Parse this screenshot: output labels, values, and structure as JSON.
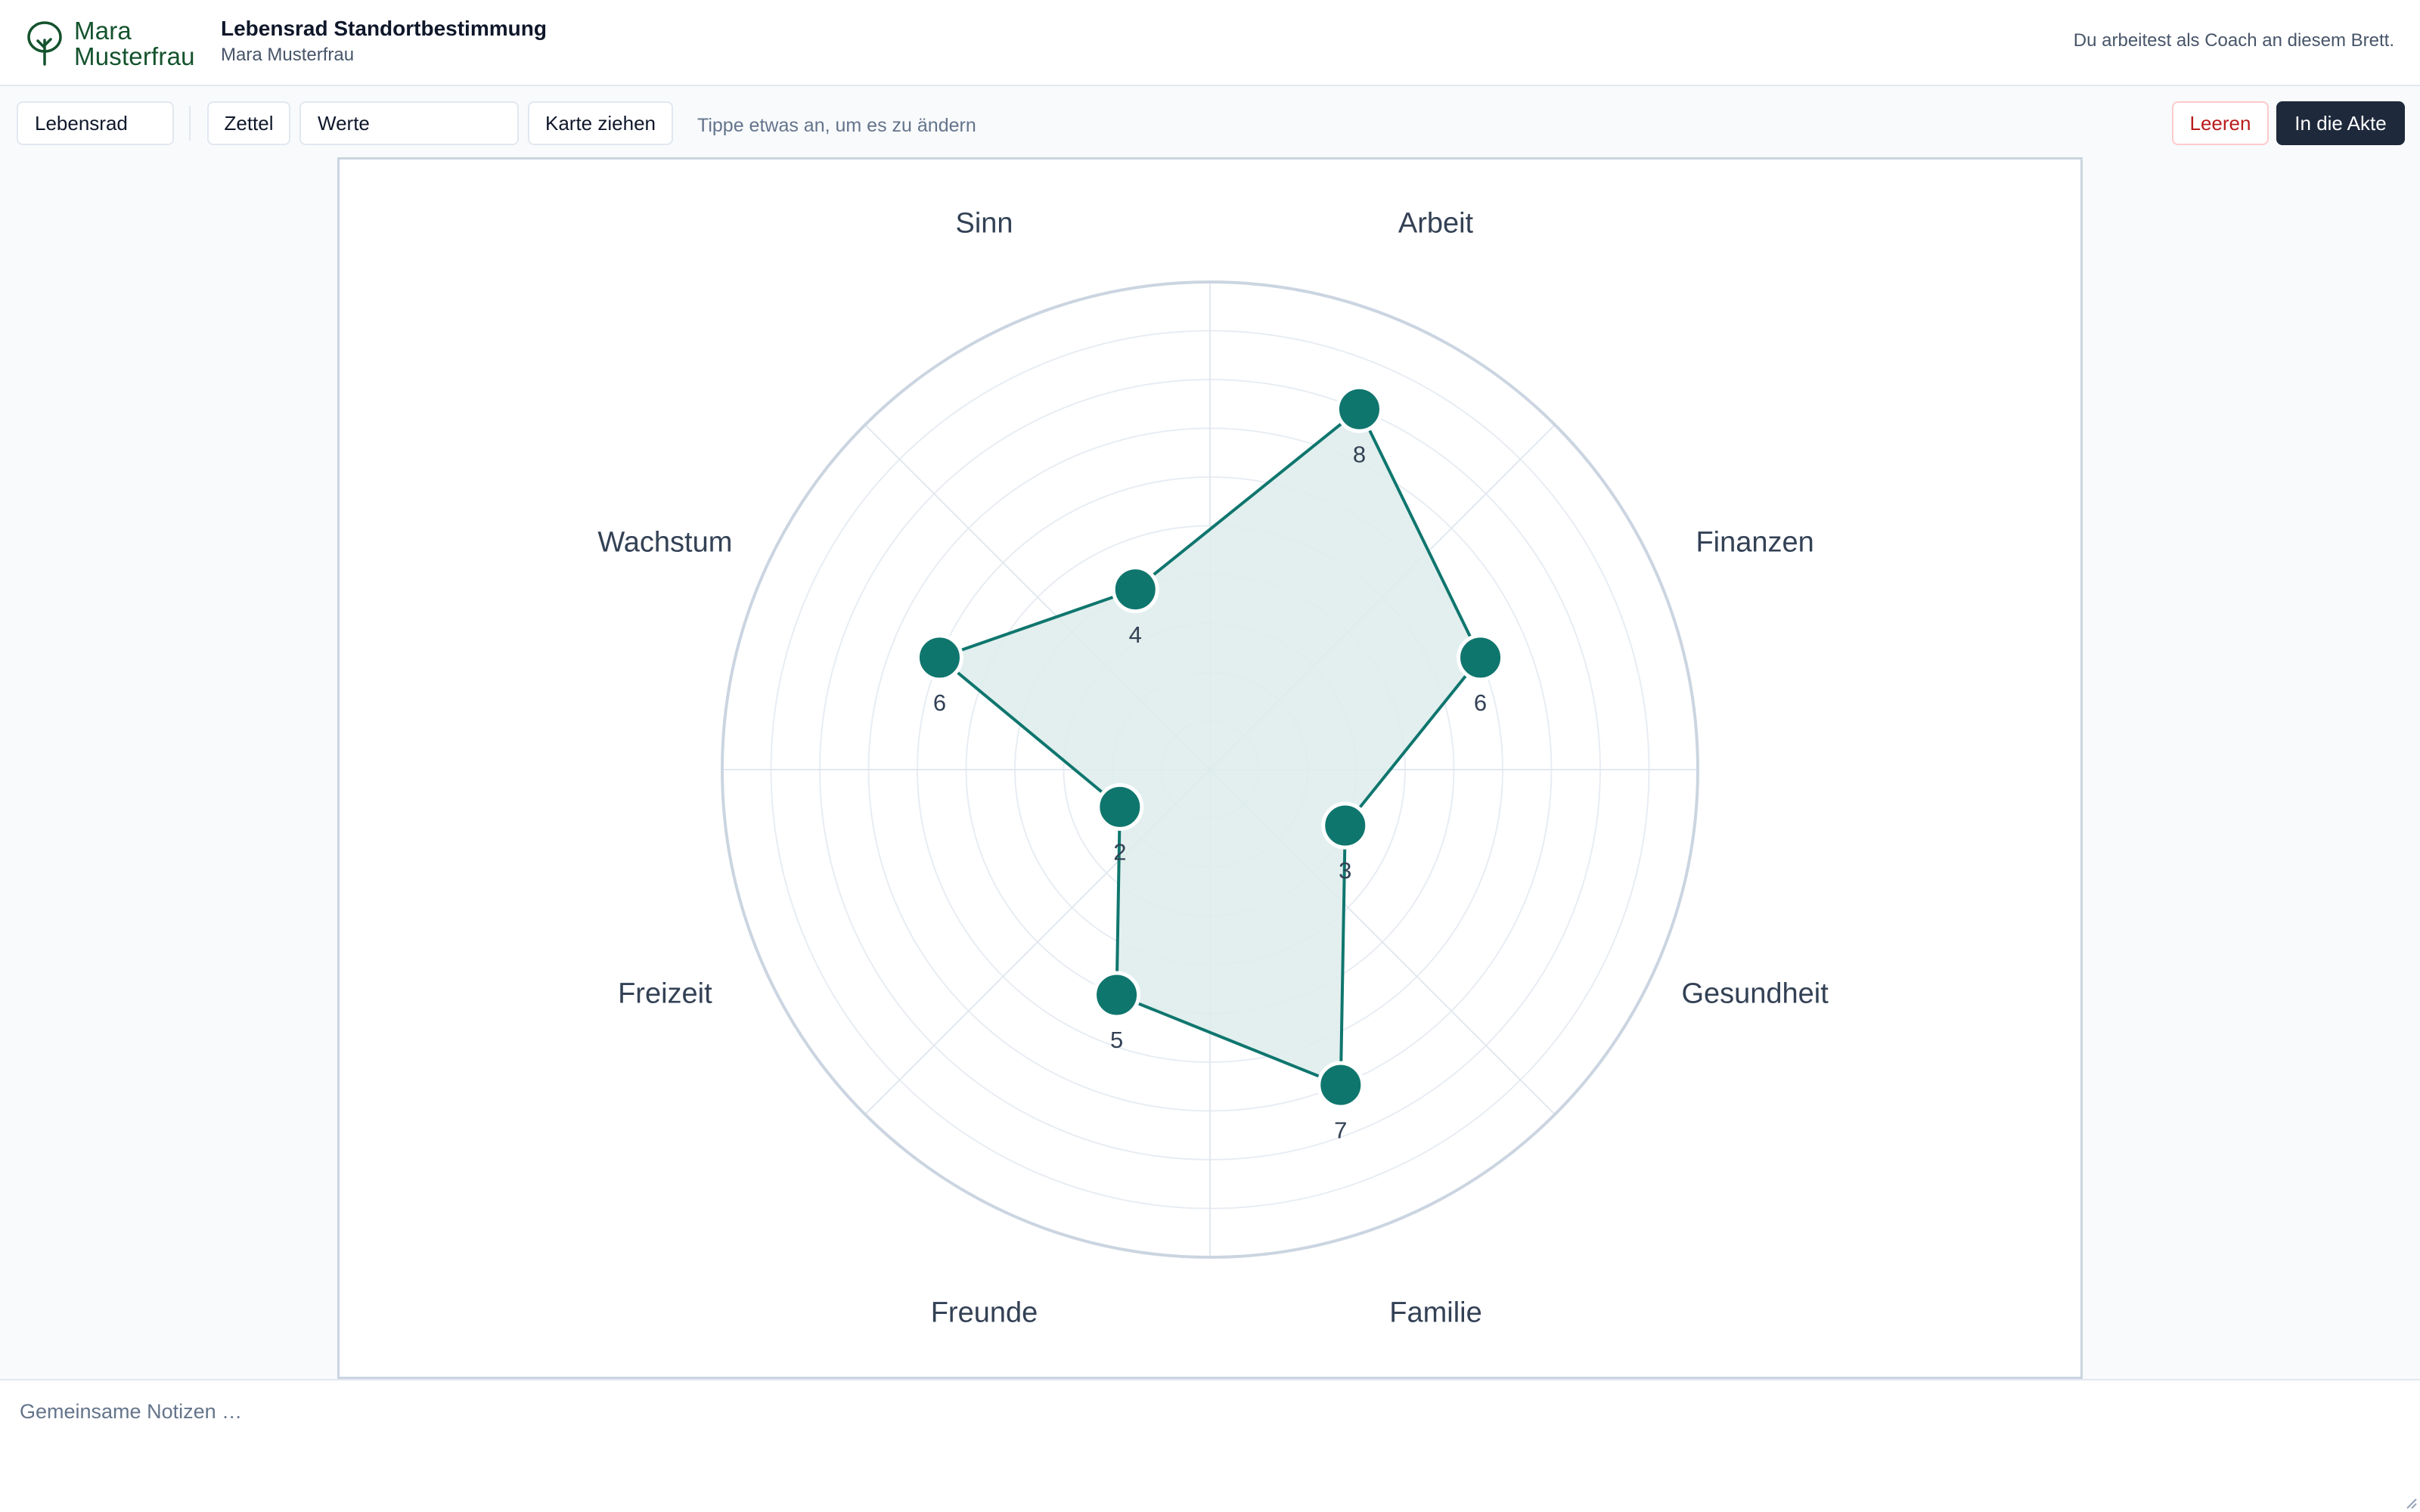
{
  "header": {
    "logo_line1": "Mara",
    "logo_line2": "Musterfrau",
    "title": "Lebensrad Standortbestimmung",
    "subtitle": "Mara Musterfrau",
    "role_text": "Du arbeitest als Coach an diesem Brett."
  },
  "toolbar": {
    "tool_select_value": "Lebensrad",
    "note_button": "Zettel",
    "note_input_value": "Werte",
    "draw_card_button": "Karte ziehen",
    "hint": "Tippe etwas an, um es zu ändern",
    "clear_button": "Leeren",
    "save_button": "In die Akte"
  },
  "colors": {
    "accent": "#0f766e",
    "accent_fill": "#ddeceb",
    "primary_button": "#1e293b",
    "danger": "#b91c1c",
    "logo": "#14532d"
  },
  "icons": {
    "logo": "tree-icon"
  },
  "chart_data": {
    "type": "radar",
    "categories": [
      "Arbeit",
      "Finanzen",
      "Gesundheit",
      "Familie",
      "Freunde",
      "Freizeit",
      "Wachstum",
      "Sinn"
    ],
    "values": [
      8,
      6,
      3,
      7,
      5,
      2,
      6,
      4
    ],
    "rmax": 10,
    "rings": 10,
    "grid": true,
    "title": "",
    "legend": "none"
  },
  "notes": {
    "placeholder": "Gemeinsame Notizen …",
    "value": ""
  }
}
